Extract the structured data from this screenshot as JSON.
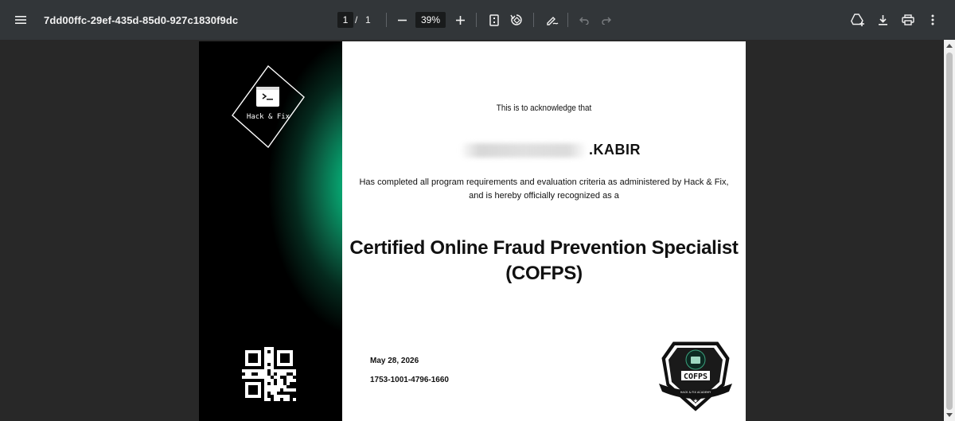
{
  "toolbar": {
    "title": "7dd00ffc-29ef-435d-85d0-927c1830f9dc",
    "page_current": "1",
    "page_separator": "/",
    "page_total": "1",
    "zoom": "39%"
  },
  "certificate": {
    "brand": "Hack & Fix",
    "acknowledge": "This is to acknowledge that",
    "recipient_visible": ".KABIR",
    "completed_line1": "Has completed all program requirements and evaluation criteria as administered by Hack & Fix,",
    "completed_line2": "and is hereby officially recognized as a",
    "course_line1": "Certified Online Fraud Prevention Specialist",
    "course_line2": "(COFPS)",
    "date": "May 28, 2026",
    "certificate_id": "1753-1001-4796-1660",
    "badge_title": "COFPS",
    "badge_ribbon": "HACK & FIX ACADEMY"
  },
  "colors": {
    "toolbar_bg": "#323639",
    "viewer_bg": "#282828",
    "accent_green": "#00c58a"
  }
}
